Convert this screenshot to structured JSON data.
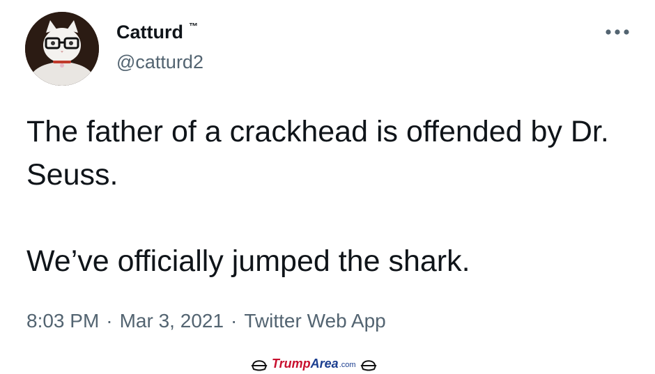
{
  "tweet": {
    "author": {
      "display_name": "Catturd",
      "trademark": "™",
      "handle": "@catturd2",
      "avatar": "white-cat-with-glasses"
    },
    "more_icon": "more-horizontal-icon",
    "text": [
      "The father of a crackhead is offended by Dr. Seuss.",
      "We’ve officially jumped the shark."
    ],
    "time": "8:03 PM",
    "separator": "·",
    "date": "Mar 3, 2021",
    "source": "Twitter Web App"
  },
  "watermark": {
    "brand_red": "Trump",
    "brand_blue": "Area",
    "suffix": ".com",
    "icon": "hat-icon"
  },
  "colors": {
    "text_primary": "#0f1419",
    "text_secondary": "#536471",
    "watermark_red": "#c8102e",
    "watermark_blue": "#1a3d8f"
  }
}
